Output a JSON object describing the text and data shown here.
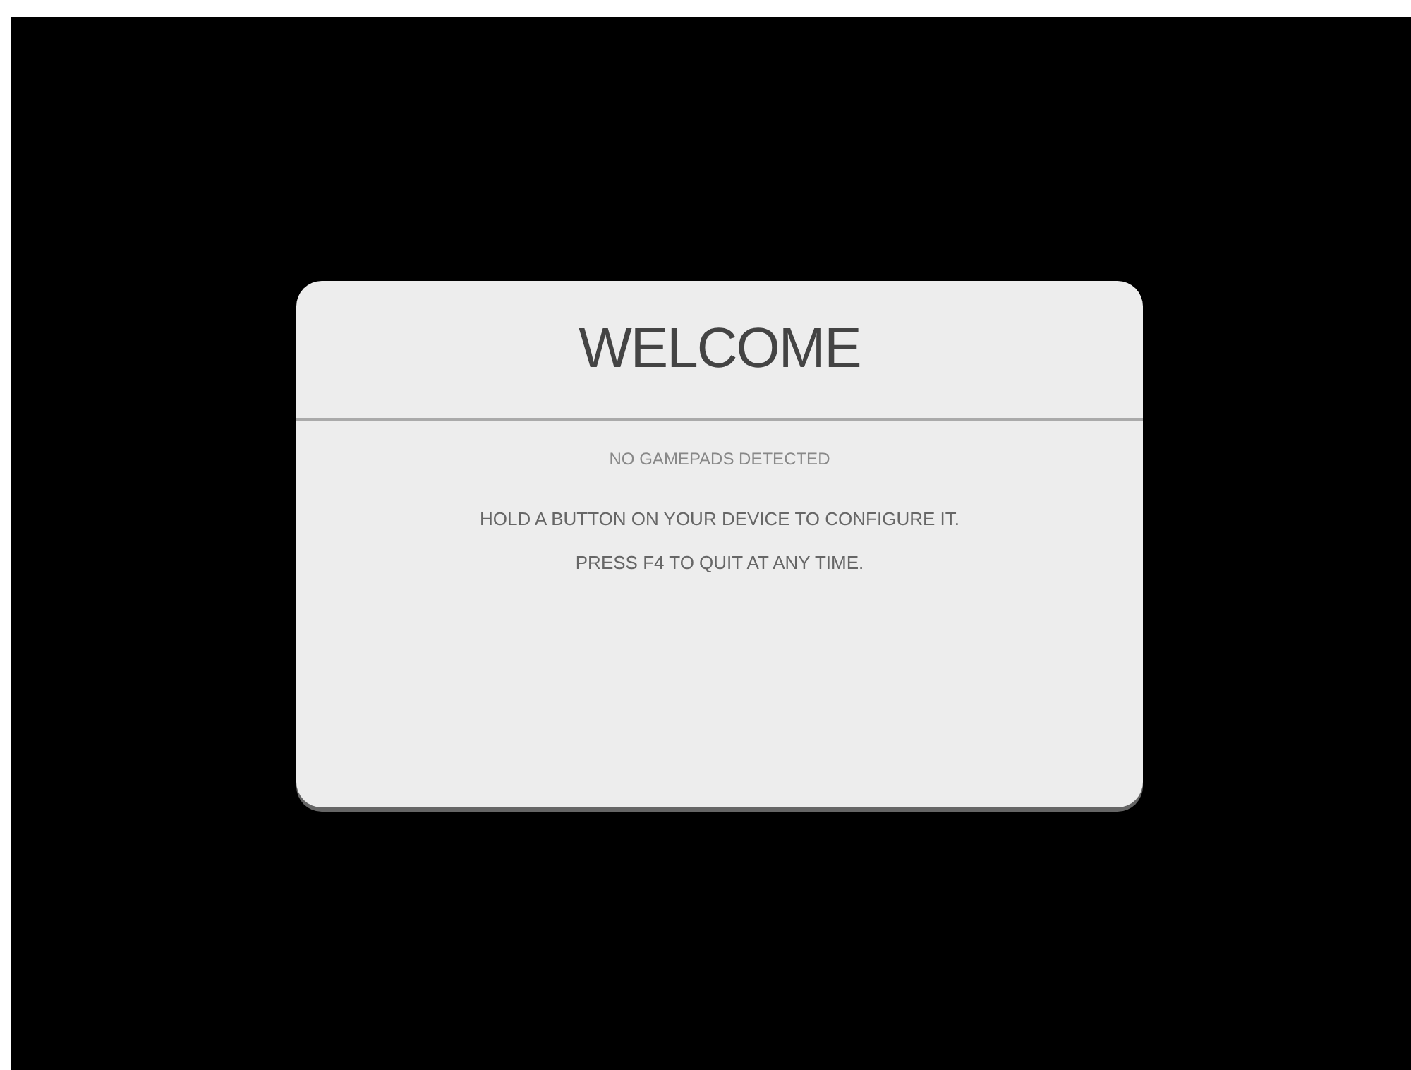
{
  "dialog": {
    "title": "WELCOME",
    "status": "NO GAMEPADS DETECTED",
    "instructions": [
      "HOLD A BUTTON ON YOUR DEVICE TO CONFIGURE IT.",
      "PRESS F4 TO QUIT AT ANY TIME."
    ]
  }
}
